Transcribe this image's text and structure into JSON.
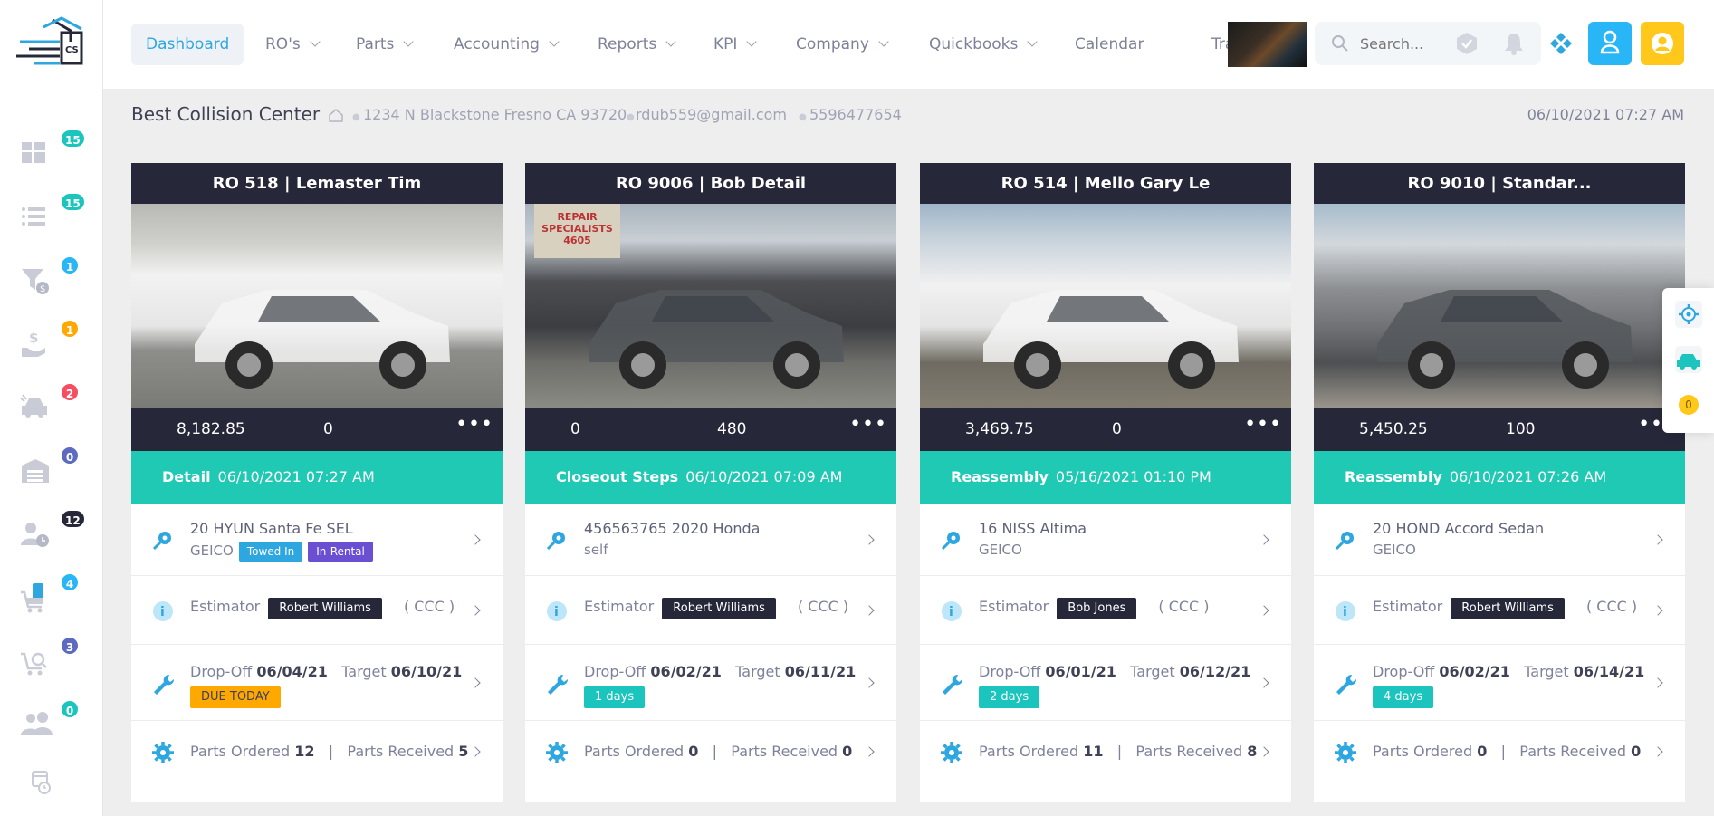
{
  "nav": {
    "items": [
      {
        "label": "Dashboard",
        "active": true,
        "dropdown": false
      },
      {
        "label": "RO's",
        "dropdown": true
      },
      {
        "label": "Parts",
        "dropdown": true
      },
      {
        "label": "Accounting",
        "dropdown": true
      },
      {
        "label": "Reports",
        "dropdown": true
      },
      {
        "label": "KPI",
        "dropdown": true
      },
      {
        "label": "Company",
        "dropdown": true
      },
      {
        "label": "Quickbooks",
        "dropdown": true
      },
      {
        "label": "Calendar",
        "dropdown": false
      },
      {
        "label": "Training",
        "dropdown": false
      }
    ],
    "search_placeholder": "Search..."
  },
  "sidebar": {
    "items": [
      {
        "icon": "dashboard-grid-icon",
        "badge": "15",
        "badge_color": "#1bc5bd"
      },
      {
        "icon": "list-icon",
        "badge": "15",
        "badge_color": "#1bc5bd"
      },
      {
        "icon": "filter-dollar-icon",
        "badge": "1",
        "badge_color": "#29b6f6"
      },
      {
        "icon": "hand-dollar-icon",
        "badge": "1",
        "badge_color": "#ffa800"
      },
      {
        "icon": "car-crash-icon",
        "badge": "2",
        "badge_color": "#f64e60"
      },
      {
        "icon": "warehouse-icon",
        "badge": "0",
        "badge_color": "#5c6bc0"
      },
      {
        "icon": "user-clock-icon",
        "badge": "12",
        "badge_color": "#26283a"
      },
      {
        "icon": "mobile-cart-icon",
        "badge": "4",
        "badge_color": "#29b6f6"
      },
      {
        "icon": "cart-search-icon",
        "badge": "3",
        "badge_color": "#5c6bc0"
      },
      {
        "icon": "users-icon",
        "badge": "0",
        "badge_color": "#1bc5bd"
      },
      {
        "icon": "calendar-clock-icon",
        "badge": null
      }
    ]
  },
  "header": {
    "shop_name": "Best Collision Center",
    "address": "1234 N Blackstone Fresno CA 93720",
    "email": "rdub559@gmail.com",
    "phone": "5596477654",
    "datetime": "06/10/2021 07:27 AM"
  },
  "colors": {
    "accent": "#2ea7e0",
    "teal": "#20c9b3",
    "dark": "#26283a",
    "warning": "#ffc81a"
  },
  "cards": [
    {
      "title": "RO 518 | Lemaster Tim",
      "amount": "8,182.85",
      "hours": "0",
      "stage": "Detail",
      "stage_date": "06/10/2021 07:27 AM",
      "vehicle": "20 HYUN Santa Fe SEL",
      "insurer": "GEICO",
      "tags": [
        "Towed In",
        "In-Rental"
      ],
      "estimator_label": "Estimator",
      "estimator": "Robert Williams",
      "system": "( CCC )",
      "dropoff_label": "Drop-Off",
      "dropoff": "06/04/21",
      "target_label": "Target",
      "target": "06/10/21",
      "due": "DUE TODAY",
      "due_color": "#ffa800",
      "parts_ordered_label": "Parts Ordered",
      "parts_ordered": "12",
      "parts_received_label": "Parts Received",
      "parts_received": "5",
      "car_color": "white"
    },
    {
      "title": "RO 9006 | Bob Detail",
      "amount": "0",
      "hours": "480",
      "stage": "Closeout Steps",
      "stage_date": "06/10/2021 07:09 AM",
      "vehicle": "456563765 2020 Honda",
      "insurer": "self",
      "tags": [],
      "estimator_label": "Estimator",
      "estimator": "Robert Williams",
      "system": "( CCC )",
      "dropoff_label": "Drop-Off",
      "dropoff": "06/02/21",
      "target_label": "Target",
      "target": "06/11/21",
      "due": "1 days",
      "due_color": "#1bc5bd",
      "parts_ordered_label": "Parts Ordered",
      "parts_ordered": "0",
      "parts_received_label": "Parts Received",
      "parts_received": "0",
      "car_color": "gray",
      "sign_text": "REPAIR SPECIALISTS 4605"
    },
    {
      "title": "RO 514 | Mello Gary Le",
      "amount": "3,469.75",
      "hours": "0",
      "stage": "Reassembly",
      "stage_date": "05/16/2021 01:10 PM",
      "vehicle": "16 NISS Altima",
      "insurer": "GEICO",
      "tags": [],
      "estimator_label": "Estimator",
      "estimator": "Bob Jones",
      "system": "( CCC )",
      "dropoff_label": "Drop-Off",
      "dropoff": "06/01/21",
      "target_label": "Target",
      "target": "06/12/21",
      "due": "2 days",
      "due_color": "#1bc5bd",
      "parts_ordered_label": "Parts Ordered",
      "parts_ordered": "11",
      "parts_received_label": "Parts Received",
      "parts_received": "8",
      "car_color": "white"
    },
    {
      "title": "RO 9010 | Standar...",
      "amount": "5,450.25",
      "hours": "100",
      "stage": "Reassembly",
      "stage_date": "06/10/2021 07:26 AM",
      "vehicle": "20 HOND Accord Sedan",
      "insurer": "GEICO",
      "tags": [],
      "estimator_label": "Estimator",
      "estimator": "Robert Williams",
      "system": "( CCC )",
      "dropoff_label": "Drop-Off",
      "dropoff": "06/02/21",
      "target_label": "Target",
      "target": "06/14/21",
      "due": "4 days",
      "due_color": "#1bc5bd",
      "parts_ordered_label": "Parts Ordered",
      "parts_ordered": "0",
      "parts_received_label": "Parts Received",
      "parts_received": "0",
      "car_color": "gray"
    }
  ],
  "float_panel": {
    "badge": "0"
  }
}
